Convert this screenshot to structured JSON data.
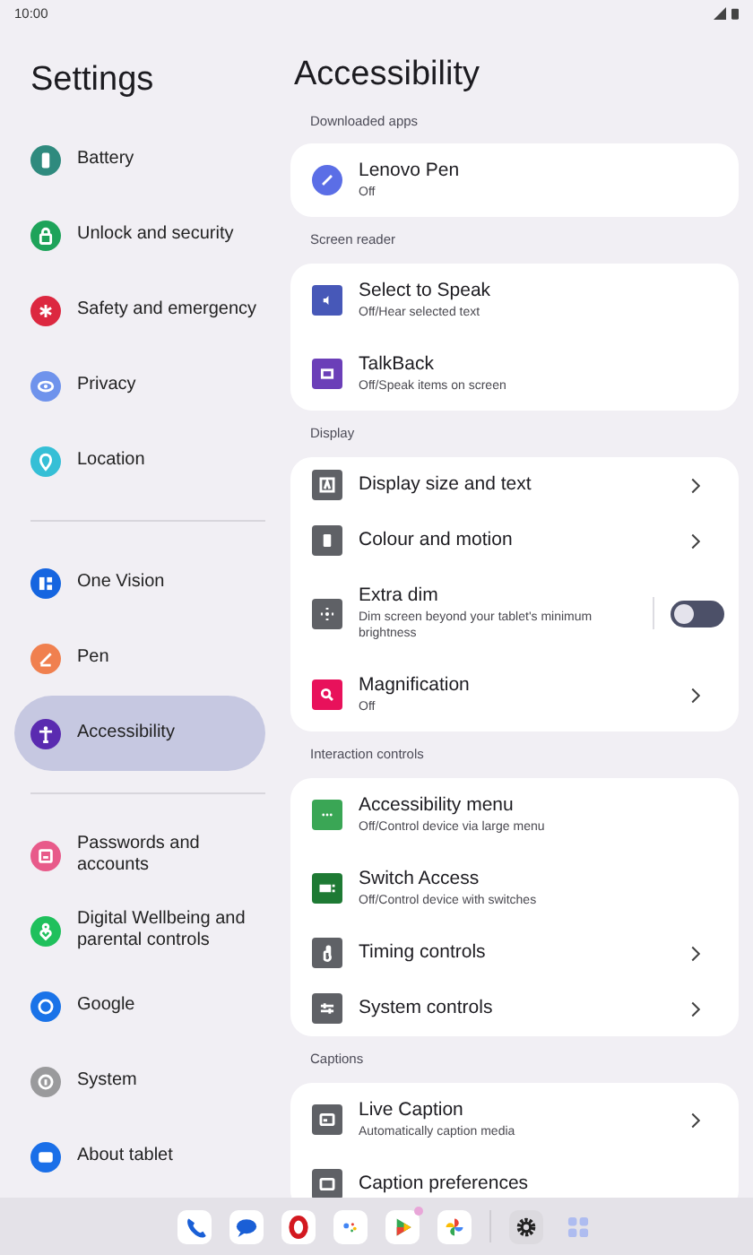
{
  "status_bar": {
    "time": "10:00"
  },
  "sidebar": {
    "title": "Settings",
    "items": [
      {
        "label": "Battery",
        "color": "#2f8a7e",
        "selected": false
      },
      {
        "label": "Unlock and security",
        "color": "#1ea35a",
        "selected": false
      },
      {
        "label": "Safety and emergency",
        "color": "#dc2840",
        "selected": false
      },
      {
        "label": "Privacy",
        "color": "#6f93ec",
        "selected": false
      },
      {
        "label": "Location",
        "color": "#35bfd6",
        "selected": false
      },
      {
        "kind": "divider"
      },
      {
        "label": "One Vision",
        "color": "#1565e0",
        "selected": false
      },
      {
        "label": "Pen",
        "color": "#f0804f",
        "selected": false
      },
      {
        "label": "Accessibility",
        "color": "#5a2bb0",
        "selected": true
      },
      {
        "kind": "divider"
      },
      {
        "label": "Passwords and accounts",
        "color": "#e85a8a",
        "selected": false
      },
      {
        "label": "Digital Wellbeing and parental controls",
        "color": "#1fc05c",
        "selected": false
      },
      {
        "label": "Google",
        "color": "#1a73e8",
        "selected": false
      },
      {
        "label": "System",
        "color": "#9a9a9c",
        "selected": false
      },
      {
        "label": "About tablet",
        "color": "#1a6fe8",
        "selected": false
      }
    ]
  },
  "page": {
    "title": "Accessibility",
    "sections": [
      {
        "header": "Downloaded apps",
        "items": [
          {
            "kind": "plain",
            "title": "Lenovo Pen",
            "subtitle": "Off",
            "color": "#5b6ee6"
          }
        ]
      },
      {
        "header": "Screen reader",
        "items": [
          {
            "kind": "plain",
            "title": "Select to Speak",
            "subtitle": "Off/Hear selected text",
            "color": "#4758b8"
          },
          {
            "kind": "plain",
            "title": "TalkBack",
            "subtitle": "Off/Speak items on screen",
            "color": "#6b3fb8"
          }
        ]
      },
      {
        "header": "Display",
        "items": [
          {
            "kind": "nav",
            "title": "Display size and text",
            "color": "#5f6166"
          },
          {
            "kind": "nav",
            "title": "Colour and motion",
            "color": "#5f6166"
          },
          {
            "kind": "toggle",
            "title": "Extra dim",
            "subtitle": "Dim screen beyond your tablet's minimum brightness",
            "color": "#5f6166",
            "on": false
          },
          {
            "kind": "nav",
            "title": "Magnification",
            "subtitle": "Off",
            "color": "#e8115b"
          }
        ]
      },
      {
        "header": "Interaction controls",
        "items": [
          {
            "kind": "plain",
            "title": "Accessibility menu",
            "subtitle": "Off/Control device via large menu",
            "color": "#3aa655"
          },
          {
            "kind": "plain",
            "title": "Switch Access",
            "subtitle": "Off/Control device with switches",
            "color": "#1e7a34"
          },
          {
            "kind": "nav",
            "title": "Timing controls",
            "color": "#5f6166"
          },
          {
            "kind": "nav",
            "title": "System controls",
            "color": "#5f6166"
          }
        ]
      },
      {
        "header": "Captions",
        "items": [
          {
            "kind": "nav",
            "title": "Live Caption",
            "subtitle": "Automatically caption media",
            "color": "#5f6166"
          },
          {
            "kind": "plain",
            "title": "Caption preferences",
            "color": "#5f6166"
          }
        ]
      }
    ]
  }
}
